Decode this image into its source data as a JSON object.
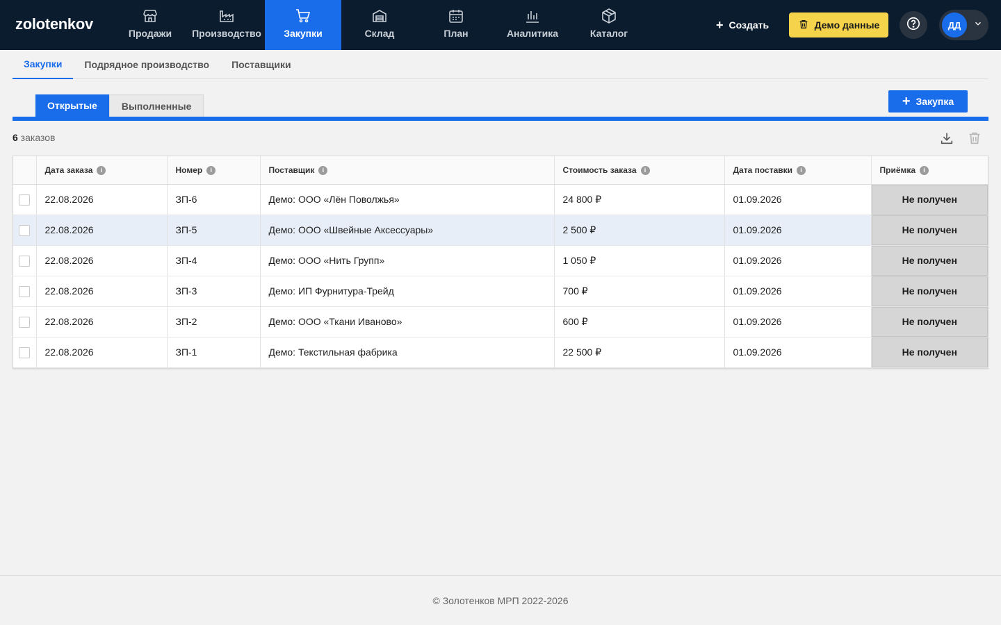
{
  "app": {
    "logo": "zolotenkov"
  },
  "nav": [
    {
      "label": "Продажи",
      "icon": "store-icon"
    },
    {
      "label": "Производство",
      "icon": "factory-icon"
    },
    {
      "label": "Закупки",
      "icon": "cart-icon",
      "active": true
    },
    {
      "label": "Склад",
      "icon": "warehouse-icon"
    },
    {
      "label": "План",
      "icon": "calendar-icon"
    },
    {
      "label": "Аналитика",
      "icon": "bar-chart-icon"
    },
    {
      "label": "Каталог",
      "icon": "box-icon"
    }
  ],
  "header": {
    "create_label": "Создать",
    "demo_label": "Демо данные",
    "avatar_initials": "ДД"
  },
  "subtabs": [
    "Закупки",
    "Подрядное производство",
    "Поставщики"
  ],
  "status_tabs": [
    "Открытые",
    "Выполненные"
  ],
  "add_button_label": "Закупка",
  "summary": {
    "count": "6",
    "count_suffix": " заказов"
  },
  "table": {
    "columns": [
      "Дата заказа",
      "Номер",
      "Поставщик",
      "Стоимость заказа",
      "Дата поставки",
      "Приёмка"
    ],
    "rows": [
      {
        "date": "22.08.2026",
        "number": "ЗП-6",
        "supplier": "Демо: ООО «Лён Поволжья»",
        "cost": "24 800 ₽",
        "delivery": "01.09.2026",
        "status": "Не получен"
      },
      {
        "date": "22.08.2026",
        "number": "ЗП-5",
        "supplier": "Демо: ООО «Швейные Аксессуары»",
        "cost": "2 500 ₽",
        "delivery": "01.09.2026",
        "status": "Не получен"
      },
      {
        "date": "22.08.2026",
        "number": "ЗП-4",
        "supplier": "Демо: ООО «Нить Групп»",
        "cost": "1 050 ₽",
        "delivery": "01.09.2026",
        "status": "Не получен"
      },
      {
        "date": "22.08.2026",
        "number": "ЗП-3",
        "supplier": "Демо: ИП Фурнитура-Трейд",
        "cost": "700 ₽",
        "delivery": "01.09.2026",
        "status": "Не получен"
      },
      {
        "date": "22.08.2026",
        "number": "ЗП-2",
        "supplier": "Демо: ООО «Ткани Иваново»",
        "cost": "600 ₽",
        "delivery": "01.09.2026",
        "status": "Не получен"
      },
      {
        "date": "22.08.2026",
        "number": "ЗП-1",
        "supplier": "Демо: Текстильная фабрика",
        "cost": "22 500 ₽",
        "delivery": "01.09.2026",
        "status": "Не получен"
      }
    ]
  },
  "footer": "© Золотенков МРП 2022-2026",
  "colors": {
    "nav_bg": "#0b1c2e",
    "accent": "#1a6dea",
    "demo_yellow": "#f5d34a",
    "highlight_row": "#e8eef8"
  }
}
